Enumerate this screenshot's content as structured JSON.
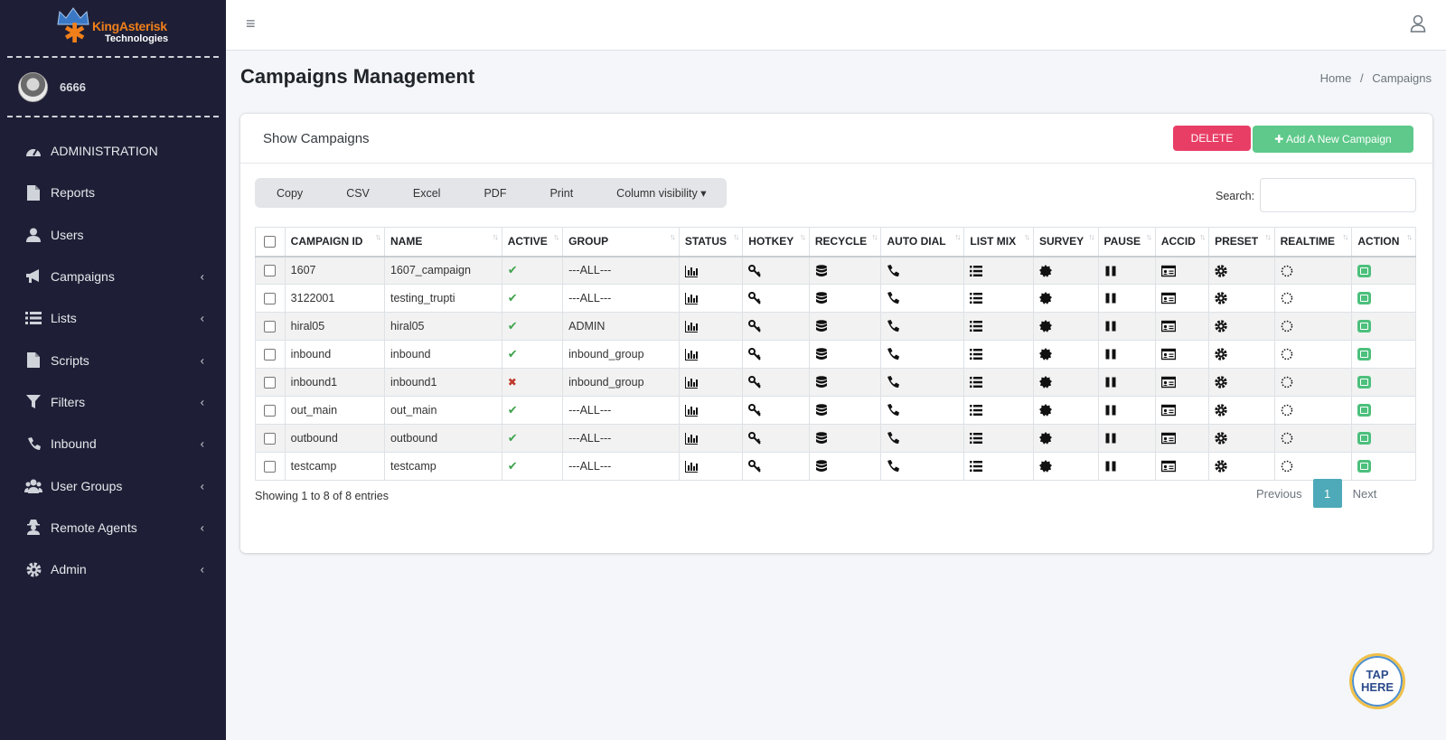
{
  "brand": {
    "name": "KingAsterisk",
    "sub": "Technologies"
  },
  "user": {
    "name": "6666"
  },
  "sidebar": {
    "items": [
      {
        "label": "ADMINISTRATION",
        "icon": "dashboard-icon",
        "has_children": false
      },
      {
        "label": "Reports",
        "icon": "file-icon",
        "has_children": false
      },
      {
        "label": "Users",
        "icon": "user-icon",
        "has_children": false
      },
      {
        "label": "Campaigns",
        "icon": "bullhorn-icon",
        "has_children": true
      },
      {
        "label": "Lists",
        "icon": "list-icon",
        "has_children": true
      },
      {
        "label": "Scripts",
        "icon": "file-icon",
        "has_children": true
      },
      {
        "label": "Filters",
        "icon": "filter-icon",
        "has_children": true
      },
      {
        "label": "Inbound",
        "icon": "phone-icon",
        "has_children": true
      },
      {
        "label": "User Groups",
        "icon": "users-icon",
        "has_children": true
      },
      {
        "label": "Remote Agents",
        "icon": "user-secret-icon",
        "has_children": true
      },
      {
        "label": "Admin",
        "icon": "gear-icon",
        "has_children": true
      }
    ]
  },
  "header": {
    "hamburger": "≡"
  },
  "page": {
    "title": "Campaigns Management",
    "breadcrumb": {
      "home": "Home",
      "sep": "/",
      "current": "Campaigns"
    }
  },
  "card": {
    "title": "Show Campaigns",
    "delete_label": "DELETE",
    "add_label": "✚ Add A New Campaign",
    "export_buttons": [
      "Copy",
      "CSV",
      "Excel",
      "PDF",
      "Print",
      "Column visibility ▾"
    ],
    "search_label": "Search:",
    "search_value": ""
  },
  "table": {
    "columns": [
      "CAMPAIGN ID",
      "NAME",
      "ACTIVE",
      "GROUP",
      "STATUS",
      "HOTKEY",
      "RECYCLE",
      "AUTO DIAL",
      "LIST MIX",
      "SURVEY",
      "PAUSE",
      "ACCID",
      "PRESET",
      "REALTIME",
      "ACTION"
    ],
    "rows": [
      {
        "id": "1607",
        "name": "1607_campaign",
        "active": true,
        "group": "---ALL---"
      },
      {
        "id": "3122001",
        "name": "testing_trupti",
        "active": true,
        "group": "---ALL---"
      },
      {
        "id": "hiral05",
        "name": "hiral05",
        "active": true,
        "group": "ADMIN"
      },
      {
        "id": "inbound",
        "name": "inbound",
        "active": true,
        "group": "inbound_group"
      },
      {
        "id": "inbound1",
        "name": "inbound1",
        "active": false,
        "group": "inbound_group"
      },
      {
        "id": "out_main",
        "name": "out_main",
        "active": true,
        "group": "---ALL---"
      },
      {
        "id": "outbound",
        "name": "outbound",
        "active": true,
        "group": "---ALL---"
      },
      {
        "id": "testcamp",
        "name": "testcamp",
        "active": true,
        "group": "---ALL---"
      }
    ]
  },
  "footer": {
    "showing": "Showing 1 to 8 of 8 entries",
    "previous": "Previous",
    "current_page": "1",
    "next": "Next"
  },
  "tap": {
    "line1": "TAP",
    "line2": "HERE"
  },
  "colors": {
    "sidebar": "#1e1f36",
    "delete": "#e83e66",
    "add": "#5ec98a",
    "page_active": "#4eaab8",
    "check": "#3fa34d",
    "cross": "#c0392b"
  }
}
